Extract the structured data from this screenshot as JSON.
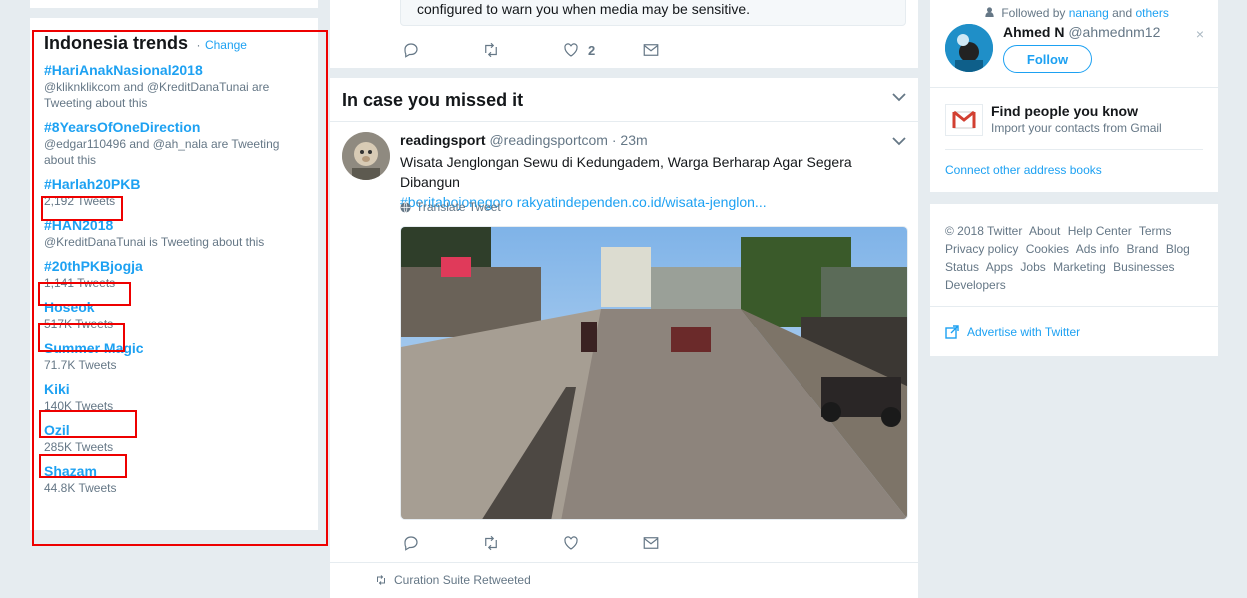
{
  "trends": {
    "title": "Indonesia trends",
    "dot": "·",
    "change": "Change",
    "items": [
      {
        "name": "#HariAnakNasional2018",
        "meta": "@kliknklikcom and @KreditDanaTunai are Tweeting about this"
      },
      {
        "name": "#8YearsOfOneDirection",
        "meta": "@edgar110496 and @ah_nala are Tweeting about this"
      },
      {
        "name": "#Harlah20PKB",
        "meta": "2,192 Tweets"
      },
      {
        "name": "#HAN2018",
        "meta": "@KreditDanaTunai is Tweeting about this"
      },
      {
        "name": "#20thPKBjogja",
        "meta": "1,141 Tweets"
      },
      {
        "name": "Hoseok",
        "meta": "517K Tweets"
      },
      {
        "name": "Summer Magic",
        "meta": "71.7K Tweets"
      },
      {
        "name": "Kiki",
        "meta": "140K Tweets"
      },
      {
        "name": "Ozil",
        "meta": "285K Tweets"
      },
      {
        "name": "Shazam",
        "meta": "44.8K Tweets"
      }
    ]
  },
  "prev_tweet": {
    "sensitive_text": "configured to warn you when media may be sensitive.",
    "like_count": "2"
  },
  "missed": {
    "title": "In case you missed it",
    "tweet": {
      "user": "readingsport",
      "handle": "@readingsportcom",
      "time": "· 23m",
      "text": "Wisata Jenglongan Sewu di Kedungadem, Warga Berharap Agar Segera Dibangun",
      "hashtag": "#beritabojonegoro",
      "link": "rakyatindependen.co.id/wisata-jenglon...",
      "translate": "Translate Tweet"
    }
  },
  "curation": {
    "text": "Curation Suite Retweeted"
  },
  "who_to_follow": {
    "followed_prefix": "Followed by",
    "followed_user": "nanang",
    "followed_and": "and",
    "followed_others": "others",
    "name": "Ahmed N",
    "handle": "@ahmednm12",
    "close": "×",
    "follow": "Follow",
    "find_title": "Find people you know",
    "find_sub": "Import your contacts from Gmail",
    "connect": "Connect other address books"
  },
  "footer": {
    "links": [
      "© 2018 Twitter",
      "About",
      "Help Center",
      "Terms",
      "Privacy policy",
      "Cookies",
      "Ads info",
      "Brand",
      "Blog",
      "Status",
      "Apps",
      "Jobs",
      "Marketing",
      "Businesses",
      "Developers"
    ],
    "advertise": "Advertise with Twitter"
  },
  "colors": {
    "accent": "#1da1f2",
    "highlight": "#e00000",
    "background": "#e6ecf0"
  }
}
